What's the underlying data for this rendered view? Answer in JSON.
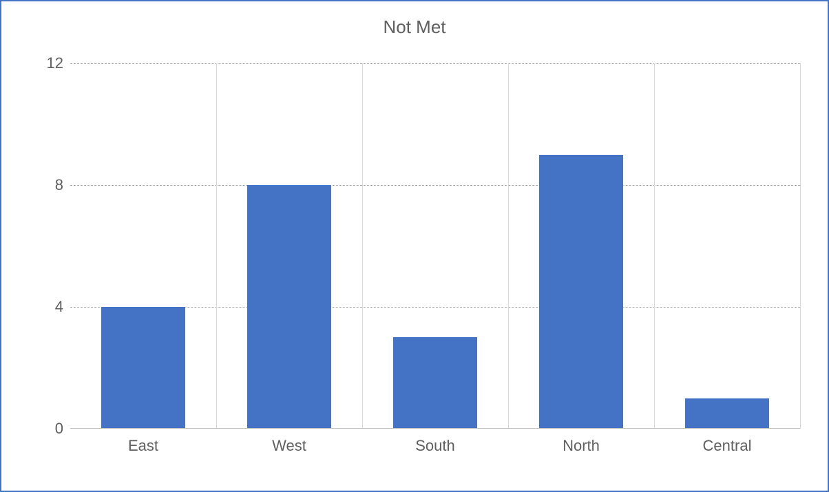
{
  "chart_data": {
    "type": "bar",
    "title": "Not Met",
    "xlabel": "",
    "ylabel": "",
    "ylim": [
      0,
      12
    ],
    "yticks": [
      0,
      4,
      8,
      12
    ],
    "categories": [
      "East",
      "West",
      "South",
      "North",
      "Central"
    ],
    "values": [
      4,
      8,
      3,
      9,
      1
    ],
    "bar_color": "#4472c4",
    "grid": "dashed"
  }
}
